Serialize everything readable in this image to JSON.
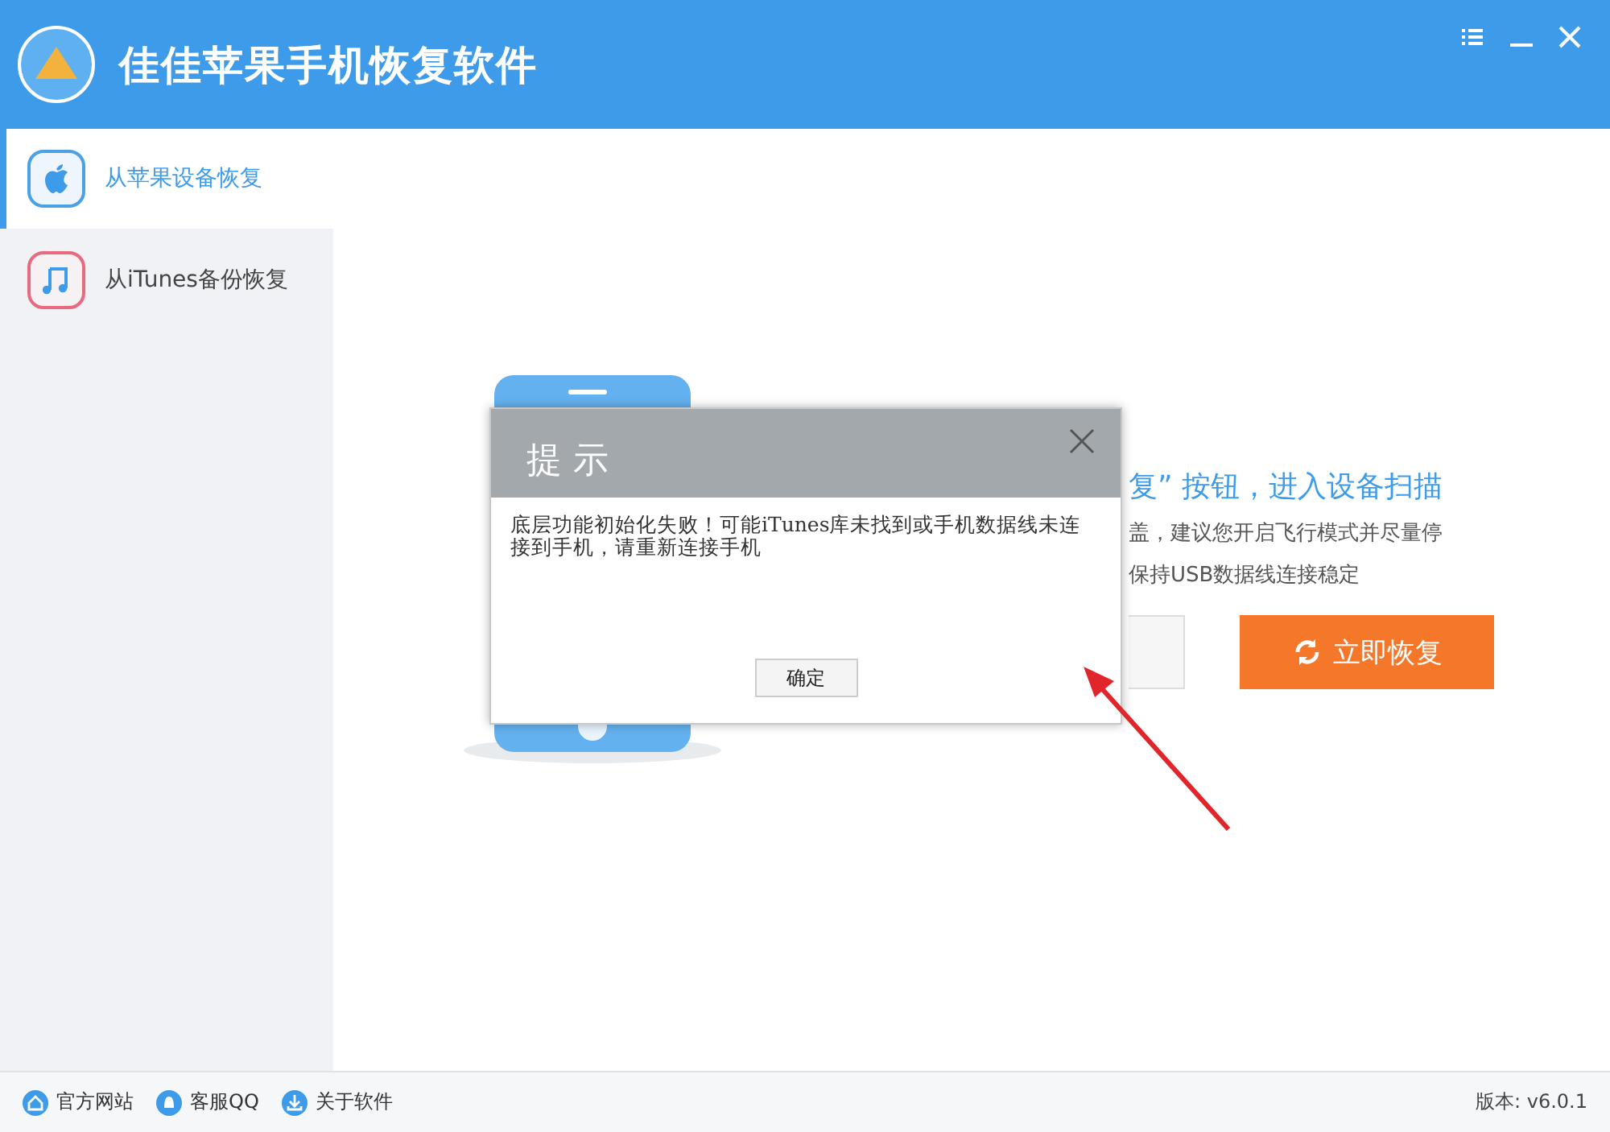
{
  "title_bar": {
    "title": "佳佳苹果手机恢复软件"
  },
  "sidebar": {
    "items": [
      {
        "label": "从苹果设备恢复",
        "selected": true,
        "kind": "apple"
      },
      {
        "label": "从iTunes备份恢复",
        "selected": false,
        "kind": "music"
      }
    ]
  },
  "main": {
    "heading": "复” 按钮，进入设备扫描",
    "notes": [
      "盖，建议您开启飞行模式并尽量停",
      "保持USB数据线连接稳定"
    ],
    "primary_button": "立即恢复"
  },
  "dialog": {
    "title": "提 示",
    "message": "底层功能初始化失败！可能iTunes库未找到或手机数据线未连接到手机，请重新连接手机",
    "ok_button": "确定"
  },
  "footer": {
    "links": [
      {
        "label": "官方网站",
        "kind": "home"
      },
      {
        "label": "客服QQ",
        "kind": "qq"
      },
      {
        "label": "关于软件",
        "kind": "download"
      }
    ],
    "version": "版本: v6.0.1"
  }
}
